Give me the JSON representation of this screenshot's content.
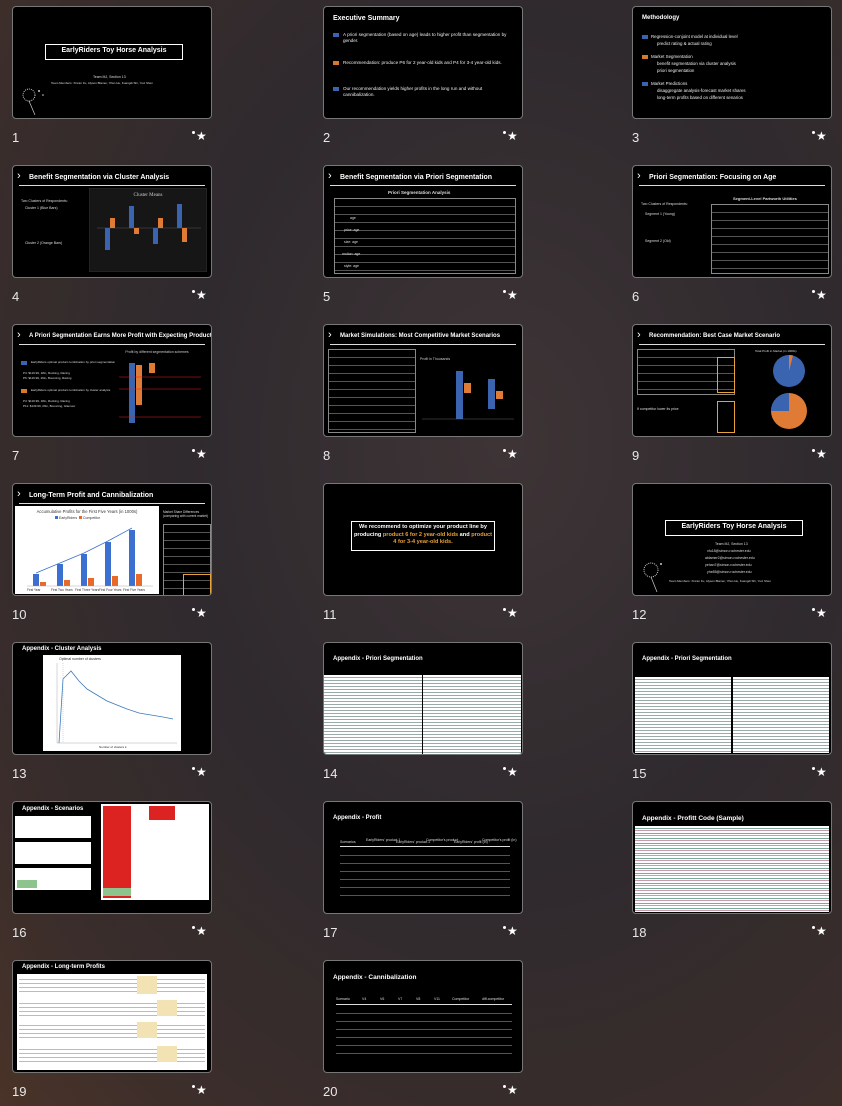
{
  "slides": [
    {
      "number": "1",
      "title": "EarlyRiders Toy Horse Analysis",
      "lines": [
        "Team MJ, Section 13",
        "Team Members: Xinran Fu, Alyson Blamer, Yifan He, Kuangdi Shi, Yuxi Shen"
      ]
    },
    {
      "number": "2",
      "title": "Executive Summary",
      "bullets": [
        "A priori segmentation (based on age) leads to higher profit than segmentation by gender.",
        "Recommendation: produce P6 for 2 year-old kids and P4 for 3-4 year-old kids.",
        "Our recommendation yields higher profits in the long run and without cannibalization."
      ]
    },
    {
      "number": "3",
      "title": "Methodology",
      "bullets": [
        "Regression-conjoint model at individual level",
        "predict rating & actual rating",
        "Market Segmentation",
        "benefit segmentation via cluster analysis",
        "priori segmentation",
        "Market Predictions",
        "disaggregate analysis-forecast market shares",
        "long-term profits based on different senarios"
      ]
    },
    {
      "number": "4",
      "title": "Benefit Segmentation via Cluster Analysis",
      "chart_title": "Cluster Means",
      "lines": [
        "Two Clusters of Respondents:",
        "Cluster 1 (Blue Bars)",
        "Cluster 2 (Orange Bars)"
      ]
    },
    {
      "number": "5",
      "title": "Benefit Segmentation via Priori Segmentation",
      "table_title": "Priori Segmentation Analysis",
      "rows": [
        "age",
        "price: age",
        "size: age",
        "motion: age",
        "style: age"
      ]
    },
    {
      "number": "6",
      "title": "Priori Segmentation: Focusing on Age",
      "table_title": "Segment-Level Partworth Utilities",
      "lines": [
        "Two Clusters of Respondents:",
        "Segment 1 (Young)",
        "Segment 2 (Old)"
      ]
    },
    {
      "number": "7",
      "title": "A Priori Segmentation Earns More Profit with Expecting Product",
      "chart_title": "Profit by different segmentation schemes",
      "lines": [
        "EarlyRiders optimal product combination by priori segmentation",
        "P4: $119.99, 18in, Rocking, Racing",
        "P6: $119.99, 26in, Bouncing, Racing",
        "EarlyRiders optimal product combination by cluster analysis",
        "P4: $119.99, 18in, Rocking, Racing",
        "P11: $139.99, 26in, Bouncing, Glamour"
      ]
    },
    {
      "number": "8",
      "title": "Market Simulations: Most Competitive Market Scenarios",
      "chart_title": "Profit in Thousands"
    },
    {
      "number": "9",
      "title": "Recommendation: Best Case Market Scenario",
      "chart_title": "Total Profit in Market (in 1000s)",
      "lines": [
        "If competitor lower its price"
      ]
    },
    {
      "number": "10",
      "title": "Long-Term Profit and Cannibalization",
      "chart_title": "Accumulative Profits for the First Five Years (in 1000s)",
      "legend": [
        "EarlyRiders",
        "Competitor"
      ],
      "categories": [
        "First Year",
        "First Two Years",
        "First Three Years",
        "First Four Years",
        "First Five Years"
      ],
      "side_title": "Market Share Differences (comparing with current market)"
    },
    {
      "number": "11",
      "lines": [
        "We recommend to optimize your product line by producing",
        "product 6 for 2 year-old kids",
        "and",
        "product 4 for 3-4 year-old kids."
      ]
    },
    {
      "number": "12",
      "title": "EarlyRiders Toy Horse Analysis",
      "lines": [
        "Team MJ, Section 13",
        "xfu18@simon.rochester.edu",
        "ablamer2@simon.rochester.edu",
        "yehan7@simon.rochester.edu",
        "yhe85@simon.rochester.edu",
        "Team Members: Xinran Fu, Alyson Blamer, Yifan He, Kuangdi Shi, Yuxi Shen"
      ]
    },
    {
      "number": "13",
      "title": "Appendix - Cluster Analysis",
      "chart_title": "Optimal number of clusters",
      "xlabel": "Number of clusters k"
    },
    {
      "number": "14",
      "title": "Appendix - Priori Segmentation"
    },
    {
      "number": "15",
      "title": "Appendix - Priori Segmentation"
    },
    {
      "number": "16",
      "title": "Appendix - Scenarios"
    },
    {
      "number": "17",
      "title": "Appendix - Profit",
      "headers": [
        "Scenarios",
        "EarlyRiders' product 1",
        "EarlyRiders' product 2",
        "Competitor's product",
        "EarlyRiders' profit (In)",
        "Competitor's profit (In)"
      ]
    },
    {
      "number": "18",
      "title": "Appendix - Profitt Code (Sample)"
    },
    {
      "number": "19",
      "title": "Appendix - Long-term Profits"
    },
    {
      "number": "20",
      "title": "Appendix - Cannibalization",
      "headers": [
        "Scenario",
        "V4",
        "V6",
        "V7",
        "V8",
        "V11",
        "Competitor",
        "diff-competitor"
      ]
    }
  ],
  "colors": {
    "accent_blue": "#3b64b0",
    "accent_orange": "#d7792b",
    "highlight_orange": "#e8a23a",
    "cyan": "#33c0e0"
  },
  "icons": {
    "favorite": "star-icon",
    "dandelion": "dandelion-icon"
  }
}
